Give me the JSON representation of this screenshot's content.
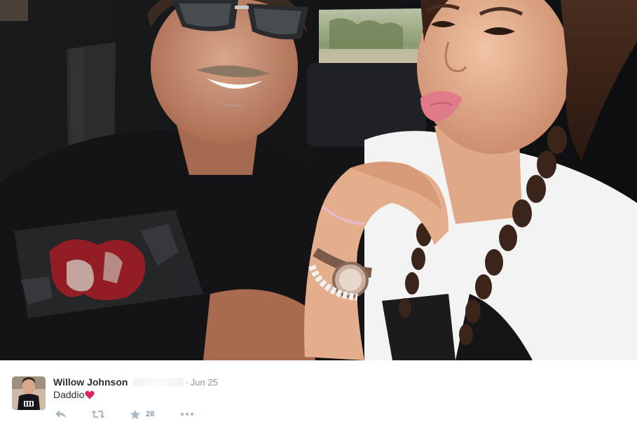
{
  "photo": {
    "icon": "photo-image"
  },
  "tweet": {
    "author_name": "Willow Johnson",
    "separator": "·",
    "date": "Jun 25",
    "text": "Daddio",
    "emoji": "heart-icon",
    "favorite_count": "28"
  },
  "actions": {
    "reply_icon": "reply-icon",
    "retweet_icon": "retweet-icon",
    "favorite_icon": "star-icon",
    "more_icon": "more-icon"
  },
  "colors": {
    "meta_text": "#8899a6",
    "action_icon": "#aab8c2",
    "heart": "#e0245e",
    "name": "#292f33"
  }
}
